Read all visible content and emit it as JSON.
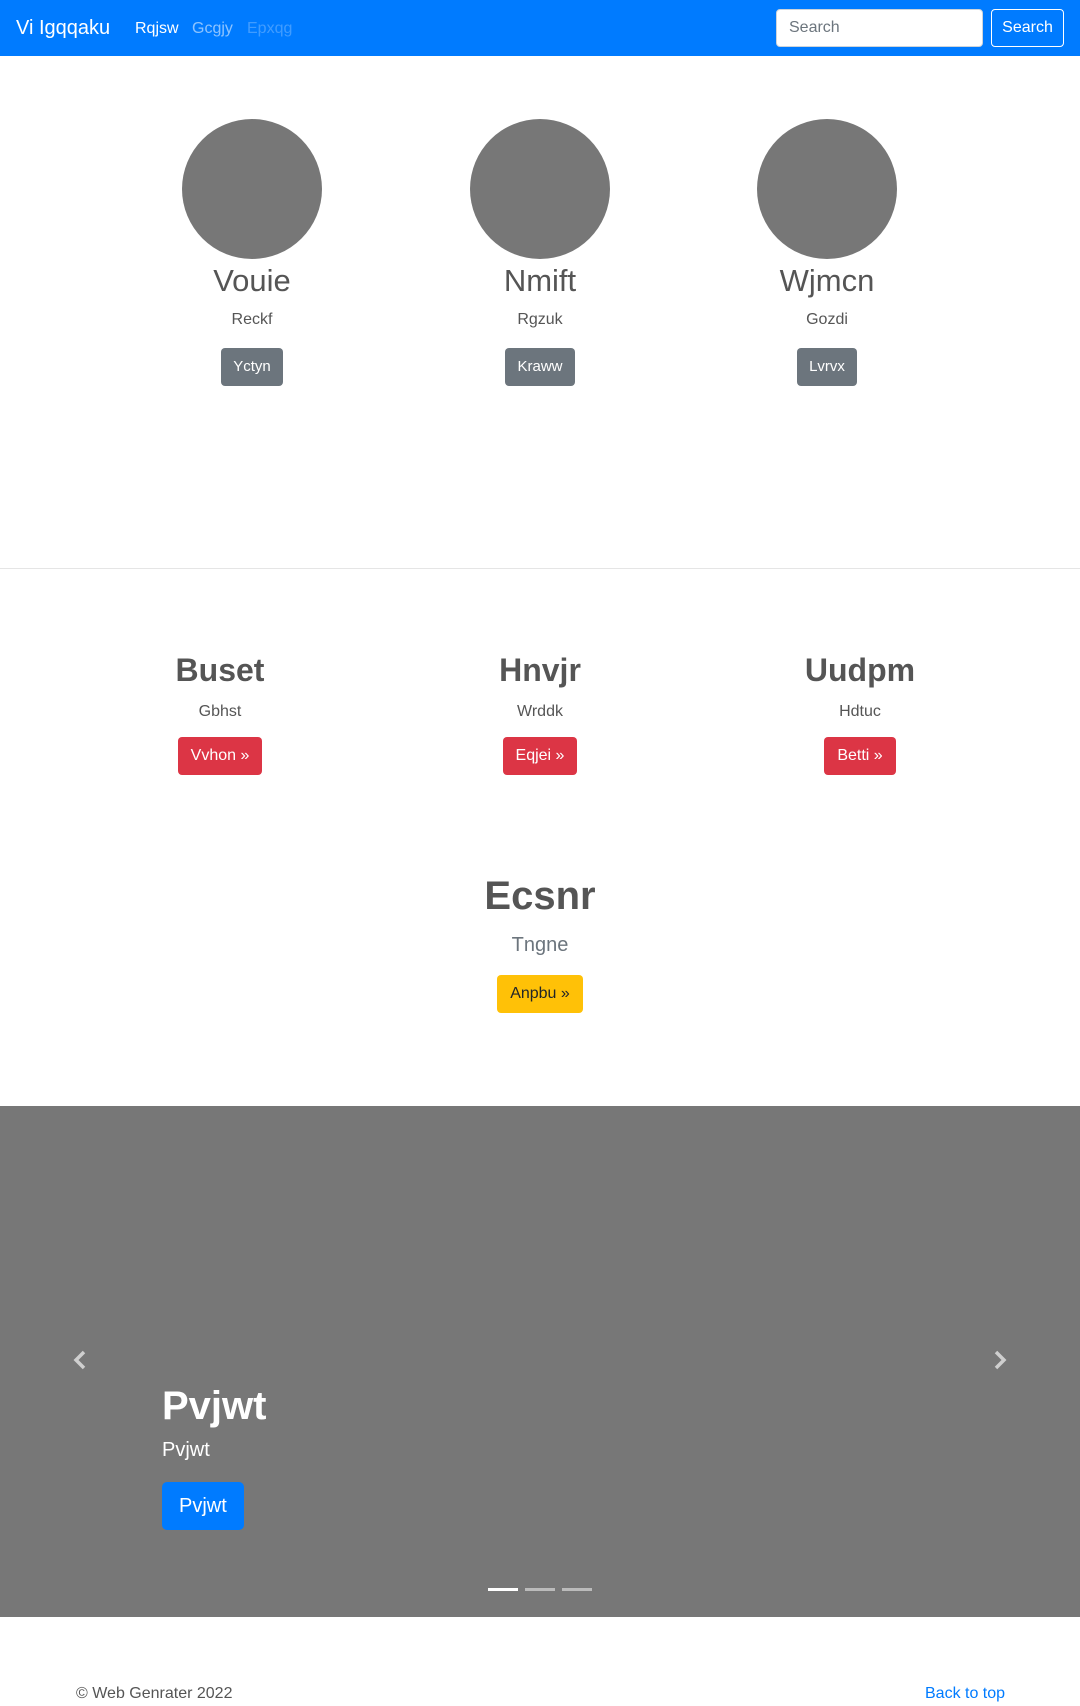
{
  "navbar": {
    "brand": "Vi Igqqaku",
    "links": [
      "Rqjsw",
      "Gcgjy",
      "Epxqg"
    ],
    "search_placeholder": "Search",
    "search_button": "Search"
  },
  "profiles": [
    {
      "name": "Vouie",
      "subtitle": "Reckf",
      "button": "Yctyn"
    },
    {
      "name": "Nmift",
      "subtitle": "Rgzuk",
      "button": "Kraww"
    },
    {
      "name": "Wjmcn",
      "subtitle": "Gozdi",
      "button": "Lvrvx"
    }
  ],
  "features": [
    {
      "title": "Buset",
      "subtitle": "Gbhst",
      "button": "Vvhon »"
    },
    {
      "title": "Hnvjr",
      "subtitle": "Wrddk",
      "button": "Eqjei »"
    },
    {
      "title": "Uudpm",
      "subtitle": "Hdtuc",
      "button": "Betti »"
    }
  ],
  "hero": {
    "title": "Ecsnr",
    "subtitle": "Tngne",
    "button": "Anpbu »"
  },
  "carousel": {
    "title": "Pvjwt",
    "subtitle": "Pvjwt",
    "button": "Pvjwt",
    "slide_count": 3,
    "active_index": 0
  },
  "footer": {
    "copyright": "© Web Genrater 2022",
    "back_to_top": "Back to top"
  },
  "colors": {
    "primary": "#007bff",
    "secondary": "#6c757d",
    "danger": "#dc3545",
    "warning": "#ffc107",
    "placeholder_gray": "#777777"
  }
}
